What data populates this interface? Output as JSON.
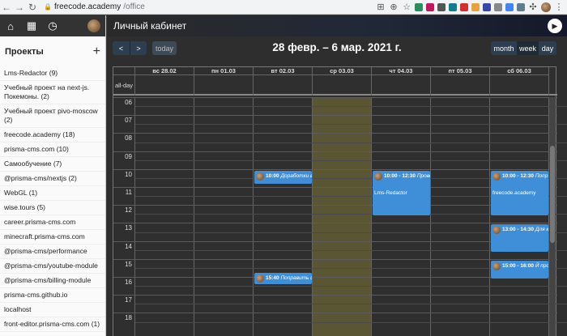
{
  "browser": {
    "url_host": "freecode.academy",
    "url_path": "/office"
  },
  "sidebar": {
    "header": "Проекты",
    "add_label": "+",
    "items": [
      "Lms-Redactor (9)",
      "Учебный проект на next-js. Покемоны. (2)",
      "Учебный проект pivo-moscow (2)",
      "freecode.academy (18)",
      "prisma-cms.com (10)",
      "Самообучение (7)",
      "@prisma-cms/nextjs (2)",
      "WebGL (1)",
      "wise.tours (5)",
      "career.prisma-cms.com",
      "minecraft.prisma-cms.com",
      "@prisma-cms/performance",
      "@prisma-cms/youtube-module",
      "@prisma-cms/billing-module",
      "prisma-cms.github.io",
      "localhost",
      "front-editor.prisma-cms.com (1)"
    ]
  },
  "main": {
    "title": "Личный кабинет"
  },
  "toolbar": {
    "prev": "<",
    "next": ">",
    "today": "today",
    "range": "28 февр. – 6 мар. 2021 г.",
    "views": {
      "month": "month",
      "week": "week",
      "day": "day"
    }
  },
  "calendar": {
    "allday_label": "all-day",
    "days": [
      "вс 28.02",
      "пн 01.03",
      "вт 02.03",
      "ср 03.03",
      "чт 04.03",
      "пт 05.03",
      "сб 06.03"
    ],
    "hours": [
      "06",
      "07",
      "08",
      "09",
      "10",
      "11",
      "12",
      "13",
      "14",
      "15",
      "16",
      "17",
      "18"
    ],
    "events": [
      {
        "time": "10:00",
        "title": "Доработки в",
        "day": 2,
        "start": 10.0,
        "end": 10.75
      },
      {
        "time": "15:40",
        "title": "Поправить ф",
        "day": 2,
        "start": 15.67,
        "end": 16.3
      },
      {
        "time": "10:00 - 12:30",
        "title": "Прове",
        "subtitle": "Lms-Redactor",
        "day": 4,
        "start": 10.0,
        "end": 12.5
      },
      {
        "time": "10:00 - 12:30",
        "title": "Попр",
        "subtitle": "freecode.academy",
        "day": 6,
        "start": 10.0,
        "end": 12.5
      },
      {
        "time": "13:00 - 14:30",
        "title": "Для к",
        "day": 6,
        "start": 13.0,
        "end": 14.5
      },
      {
        "time": "15:00 - 16:00",
        "title": "Й про",
        "day": 6,
        "start": 15.0,
        "end": 16.0
      }
    ]
  }
}
